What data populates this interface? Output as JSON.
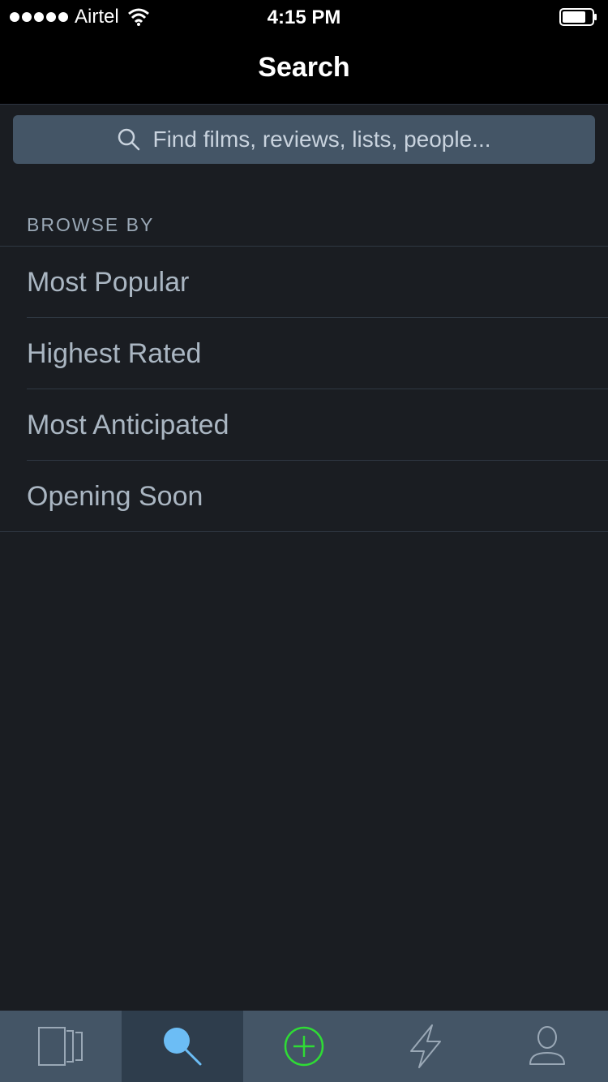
{
  "status_bar": {
    "carrier": "Airtel",
    "time": "4:15 PM",
    "signal_icon": "signal-dots-icon",
    "wifi_icon": "wifi-icon",
    "battery_icon": "battery-icon"
  },
  "nav": {
    "title": "Search"
  },
  "search": {
    "placeholder": "Find films, reviews, lists, people...",
    "icon": "search-icon"
  },
  "browse": {
    "header": "BROWSE BY",
    "items": [
      {
        "label": "Most Popular"
      },
      {
        "label": "Highest Rated"
      },
      {
        "label": "Most Anticipated"
      },
      {
        "label": "Opening Soon"
      }
    ]
  },
  "tab_bar": {
    "tabs": [
      {
        "icon": "films-icon",
        "active": false
      },
      {
        "icon": "search-icon",
        "active": true
      },
      {
        "icon": "add-icon",
        "active": false
      },
      {
        "icon": "activity-icon",
        "active": false
      },
      {
        "icon": "profile-icon",
        "active": false
      }
    ]
  },
  "colors": {
    "background": "#1a1d22",
    "search_field": "#445566",
    "tab_bar": "#445566",
    "tab_active": "#2e3d4c",
    "accent_blue": "#6cbdf5",
    "accent_green": "#2fdc35",
    "text_muted": "#aab6c2"
  }
}
